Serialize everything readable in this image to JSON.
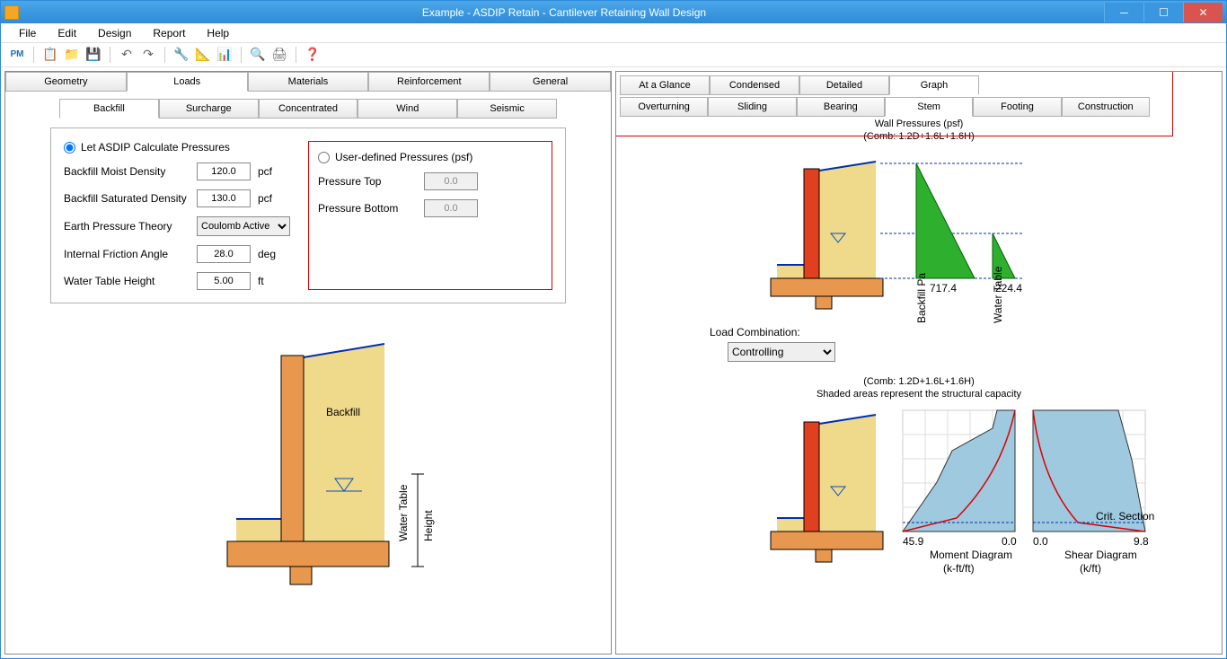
{
  "window": {
    "title": "Example - ASDIP Retain - Cantilever Retaining Wall Design"
  },
  "menu": {
    "file": "File",
    "edit": "Edit",
    "design": "Design",
    "report": "Report",
    "help": "Help"
  },
  "left_tabs": [
    "Geometry",
    "Loads",
    "Materials",
    "Reinforcement",
    "General"
  ],
  "left_active": "Loads",
  "loads_sub": [
    "Backfill",
    "Surcharge",
    "Concentrated",
    "Wind",
    "Seismic"
  ],
  "loads_sub_active": "Backfill",
  "radio1": "Let ASDIP Calculate Pressures",
  "radio2": "User-defined Pressures (psf)",
  "fields": {
    "moist_lbl": "Backfill Moist Density",
    "moist_val": "120.0",
    "moist_u": "pcf",
    "sat_lbl": "Backfill Saturated Density",
    "sat_val": "130.0",
    "sat_u": "pcf",
    "theory_lbl": "Earth Pressure Theory",
    "theory_val": "Coulomb Active",
    "fric_lbl": "Internal Friction Angle",
    "fric_val": "28.0",
    "fric_u": "deg",
    "wt_lbl": "Water Table Height",
    "wt_val": "5.00",
    "wt_u": "ft",
    "ptop_lbl": "Pressure Top",
    "ptop_val": "0.0",
    "pbot_lbl": "Pressure Bottom",
    "pbot_val": "0.0"
  },
  "diagram": {
    "backfill": "Backfill",
    "wt_label": "Water Table\nHeight"
  },
  "right_tabs_top": [
    "At a Glance",
    "Condensed",
    "Detailed",
    "Graph"
  ],
  "right_tabs_top_active": "Graph",
  "right_tabs_sub": [
    "Overturning",
    "Sliding",
    "Bearing",
    "Stem",
    "Footing",
    "Construction"
  ],
  "right_tabs_sub_active": "Stem",
  "graph": {
    "title1": "Wall Pressures (psf)",
    "comb": "(Comb: 1.2D+1.6L+1.6H)",
    "val1": "717.4",
    "val2": "224.4",
    "ylabel1": "Backfill Pa",
    "ylabel2": "Water Table",
    "load_combo_lbl": "Load Combination:",
    "load_combo": "Controlling",
    "comb2": "(Comb: 1.2D+1.6L+1.6H)",
    "shaded": "Shaded areas represent the structural capacity",
    "moment_left": "45.9",
    "moment_right": "0.0",
    "moment_title": "Moment Diagram",
    "moment_unit": "(k-ft/ft)",
    "shear_left": "0.0",
    "shear_right": "9.8",
    "shear_title": "Shear Diagram",
    "shear_unit": "(k/ft)",
    "crit": "Crit. Section"
  },
  "chart_data": {
    "type": "other",
    "pressures": {
      "backfill_pa": 717.4,
      "water_table": 224.4,
      "units": "psf"
    },
    "moment": {
      "range": [
        45.9,
        0.0
      ],
      "units": "k-ft/ft"
    },
    "shear": {
      "range": [
        0.0,
        9.8
      ],
      "units": "k/ft"
    },
    "load_combination": "1.2D+1.6L+1.6H"
  }
}
